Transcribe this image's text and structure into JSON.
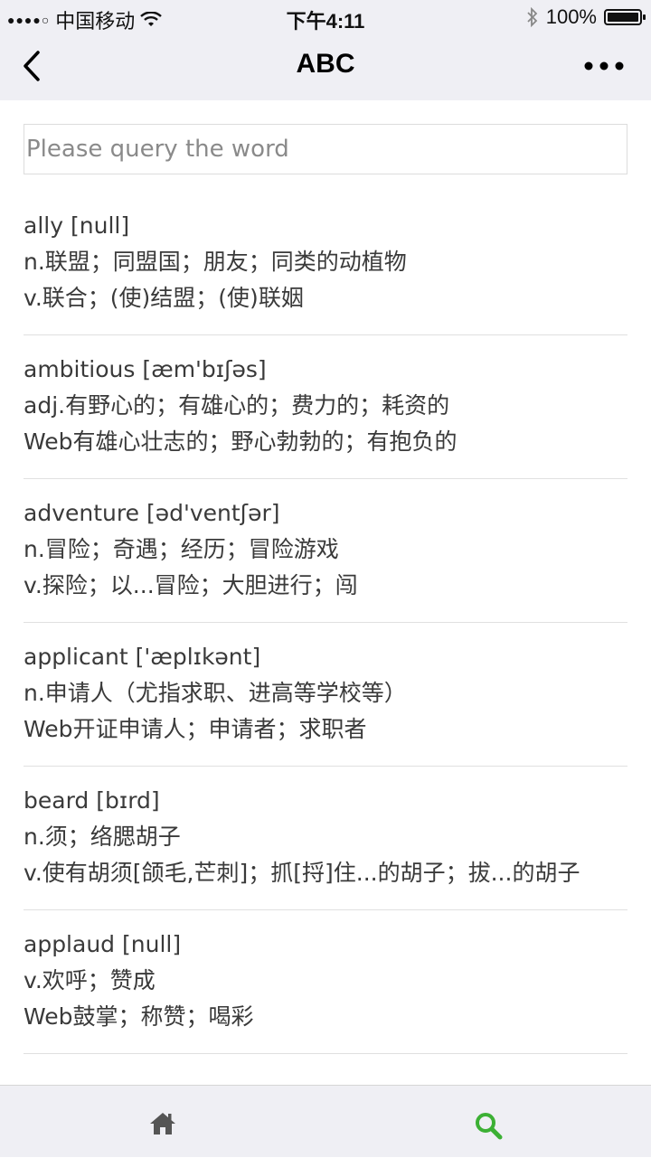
{
  "status_bar": {
    "signal_dots": "●●●●○",
    "carrier": "中国移动",
    "time": "下午4:11",
    "battery": "100%"
  },
  "nav": {
    "title": "ABC"
  },
  "search": {
    "placeholder": "Please query the word",
    "value": ""
  },
  "entries": [
    {
      "word": "ally",
      "phonetic": "[null]",
      "lines": [
        "n.联盟；同盟国；朋友；同类的动植物",
        "v.联合；(使)结盟；(使)联姻"
      ]
    },
    {
      "word": "ambitious",
      "phonetic": "[æm'bɪʃəs]",
      "lines": [
        "adj.有野心的；有雄心的；费力的；耗资的",
        "Web有雄心壮志的；野心勃勃的；有抱负的"
      ]
    },
    {
      "word": "adventure",
      "phonetic": "[əd'ventʃər]",
      "lines": [
        "n.冒险；奇遇；经历；冒险游戏",
        "v.探险；以...冒险；大胆进行；闯"
      ]
    },
    {
      "word": "applicant",
      "phonetic": "['æplɪkənt]",
      "lines": [
        "n.申请人（尤指求职、进高等学校等）",
        "Web开证申请人；申请者；求职者"
      ]
    },
    {
      "word": "beard",
      "phonetic": "[bɪrd]",
      "lines": [
        "n.须；络腮胡子",
        "v.使有胡须[颌毛,芒刺]；抓[捋]住...的胡子；拔...的胡子"
      ]
    },
    {
      "word": "applaud",
      "phonetic": "[null]",
      "lines": [
        "v.欢呼；赞成",
        "Web鼓掌；称赞；喝彩"
      ]
    }
  ],
  "tabs": {
    "home_icon": "home-icon",
    "search_icon": "search-icon",
    "active_color": "#3cb034",
    "inactive_color": "#555555"
  }
}
